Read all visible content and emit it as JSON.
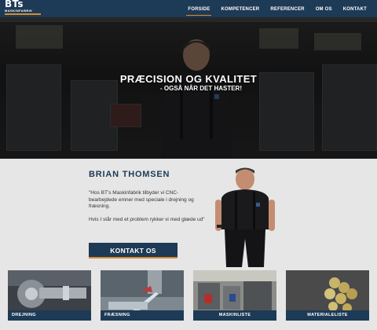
{
  "header": {
    "logo_text": "BTs",
    "logo_sub": "MASKINFABRIK",
    "nav": [
      {
        "label": "FORSIDE",
        "active": true
      },
      {
        "label": "KOMPETENCER",
        "active": false
      },
      {
        "label": "REFERENCER",
        "active": false
      },
      {
        "label": "OM OS",
        "active": false
      },
      {
        "label": "KONTAKT",
        "active": false
      }
    ]
  },
  "hero": {
    "title": "PRÆCISION OG KVALITET",
    "subtitle": "- OGSÅ NÅR DET HASTER!"
  },
  "intro": {
    "name": "BRIAN THOMSEN",
    "paragraph1": "\"Hos BT's Maskinfabrik tilbyder vi CNC-bearbejdede emner med speciale i drejning og fræsning.",
    "paragraph2": "Hvis I står med et problem rykker vi med glæde ud\"",
    "cta_label": "KONTAKT OS"
  },
  "cards": [
    {
      "label": "DREJNING",
      "image": "lathe-chuck"
    },
    {
      "label": "FRÆSNING",
      "image": "milling-coolant"
    },
    {
      "label": "MASKINLISTE",
      "image": "workshop-machines"
    },
    {
      "label": "MATERIALELISTE",
      "image": "metal-bars"
    }
  ],
  "colors": {
    "primary": "#1d3a56",
    "accent": "#d98b2b",
    "background": "#e6e6e6"
  }
}
